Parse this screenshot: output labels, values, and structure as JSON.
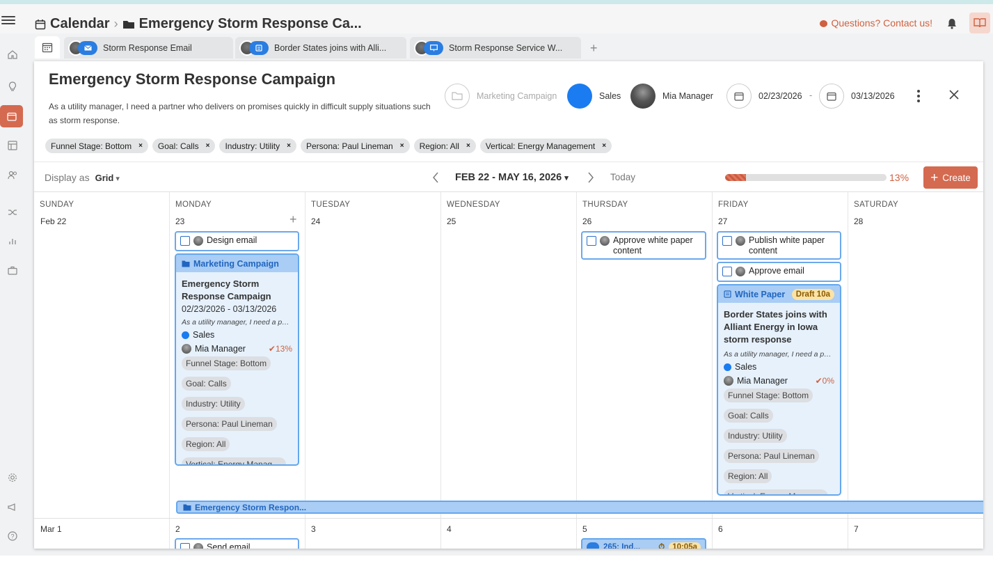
{
  "header": {
    "breadcrumb_root": "Calendar",
    "breadcrumb_current": "Emergency Storm Response Ca...",
    "questions_link": "Questions? Contact us!"
  },
  "tabs": [
    {
      "label": "Storm Response Email",
      "kind": "email"
    },
    {
      "label": "Border States joins with Alli...",
      "kind": "white-paper"
    },
    {
      "label": "Storm Response Service W...",
      "kind": "webinar"
    }
  ],
  "campaign": {
    "title": "Emergency Storm Response Campaign",
    "description": "As a utility manager, I need a partner who delivers on promises quickly in difficult supply situations such as storm response.",
    "type_label": "Marketing Campaign",
    "team": "Sales",
    "owner": "Mia Manager",
    "start_date": "02/23/2026",
    "date_separator": "-",
    "end_date": "03/13/2026",
    "tags": [
      "Funnel Stage: Bottom",
      "Goal: Calls",
      "Industry: Utility",
      "Persona: Paul Lineman",
      "Region: All",
      "Vertical: Energy Management"
    ]
  },
  "toolbar": {
    "display_as": "Display as",
    "display_mode": "Grid",
    "range": "FEB 22 - MAY 16, 2026",
    "today": "Today",
    "progress_percent": 13,
    "progress_label": "13%",
    "create": "Create"
  },
  "calendar": {
    "day_names": [
      "SUNDAY",
      "MONDAY",
      "TUESDAY",
      "WEDNESDAY",
      "THURSDAY",
      "FRIDAY",
      "SATURDAY"
    ],
    "week1_days": [
      "Feb 22",
      "23",
      "24",
      "25",
      "26",
      "27",
      "28"
    ],
    "week2_days": [
      "Mar 1",
      "2",
      "3",
      "4",
      "5",
      "6",
      "7"
    ],
    "tasks": {
      "design_email": "Design email",
      "approve_white_paper": "Approve white paper content",
      "publish_white_paper": "Publish white paper content",
      "approve_email": "Approve email",
      "send_email": "Send email"
    },
    "campaign_card": {
      "type": "Marketing Campaign",
      "title": "Emergency Storm Response Campaign",
      "dates": "02/23/2026 - 03/13/2026",
      "desc": "As a utility manager, I need a partner who delivers on promises quickly in difficult supply situations such as storm response.",
      "team": "Sales",
      "owner": "Mia Manager",
      "pct": "13%",
      "tags": [
        "Funnel Stage: Bottom",
        "Goal: Calls",
        "Industry: Utility",
        "Persona: Paul Lineman",
        "Region: All",
        "Vertical: Energy Management"
      ]
    },
    "wp_card": {
      "type": "White Paper",
      "status": "Draft 10a",
      "title": "Border States joins with Alliant Energy in Iowa storm response",
      "desc": "As a utility manager, I need a partner who delivers on promises quickly in difficult supply situations such as storm response.",
      "team": "Sales",
      "owner": "Mia Manager",
      "pct": "0%",
      "tags": [
        "Funnel Stage: Bottom",
        "Goal: Calls",
        "Industry: Utility",
        "Persona: Paul Lineman",
        "Region: All",
        "Vertical: Energy Management"
      ]
    },
    "span_bar": "Emergency Storm Respon...",
    "partial_event": {
      "label": "265: Ind...",
      "time": "10:05a"
    }
  },
  "colors": {
    "accent": "#d46a50",
    "blue": "#1a7cf0",
    "card_bg": "#e6f1fc",
    "card_border": "#64a7ee"
  }
}
